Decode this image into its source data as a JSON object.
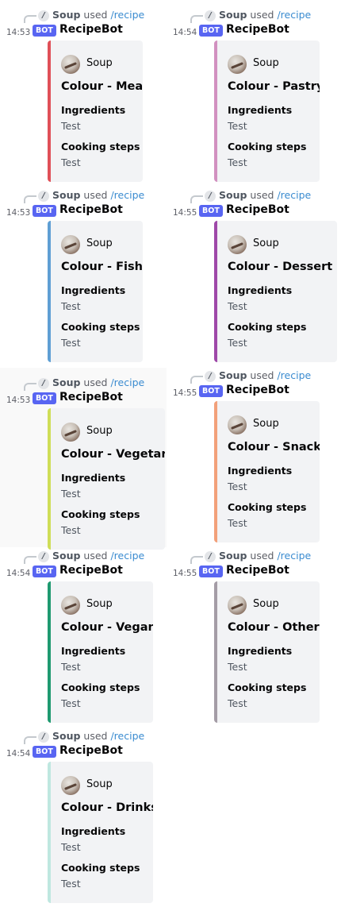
{
  "messages": [
    {
      "user": "Soup",
      "used": "used",
      "command": "/recipe",
      "time": "14:53",
      "badge": "BOT",
      "bot": "RecipeBot",
      "embed": {
        "author": "Soup",
        "title": "Colour - Meat",
        "color": "#e05058",
        "fields": [
          {
            "name": "Ingredients",
            "value": "Test"
          },
          {
            "name": "Cooking steps",
            "value": "Test"
          }
        ]
      }
    },
    {
      "user": "Soup",
      "used": "used",
      "command": "/recipe",
      "time": "14:54",
      "badge": "BOT",
      "bot": "RecipeBot",
      "embed": {
        "author": "Soup",
        "title": "Colour - Pastry",
        "color": "#d291c0",
        "fields": [
          {
            "name": "Ingredients",
            "value": "Test"
          },
          {
            "name": "Cooking steps",
            "value": "Test"
          }
        ]
      }
    },
    {
      "user": "Soup",
      "used": "used",
      "command": "/recipe",
      "time": "14:53",
      "badge": "BOT",
      "bot": "RecipeBot",
      "embed": {
        "author": "Soup",
        "title": "Colour - Fish",
        "color": "#5f9fd4",
        "fields": [
          {
            "name": "Ingredients",
            "value": "Test"
          },
          {
            "name": "Cooking steps",
            "value": "Test"
          }
        ]
      }
    },
    {
      "user": "Soup",
      "used": "used",
      "command": "/recipe",
      "time": "14:55",
      "badge": "BOT",
      "bot": "RecipeBot",
      "embed": {
        "author": "Soup",
        "title": "Colour - Dessert",
        "color": "#9e48a8",
        "fields": [
          {
            "name": "Ingredients",
            "value": "Test"
          },
          {
            "name": "Cooking steps",
            "value": "Test"
          }
        ]
      }
    },
    {
      "user": "Soup",
      "used": "used",
      "command": "/recipe",
      "time": "14:53",
      "badge": "BOT",
      "bot": "RecipeBot",
      "embed": {
        "author": "Soup",
        "title": "Colour - Vegetarian",
        "color": "#cfde58",
        "fields": [
          {
            "name": "Ingredients",
            "value": "Test"
          },
          {
            "name": "Cooking steps",
            "value": "Test"
          }
        ]
      }
    },
    {
      "user": "Soup",
      "used": "used",
      "command": "/recipe",
      "time": "14:55",
      "badge": "BOT",
      "bot": "RecipeBot",
      "embed": {
        "author": "Soup",
        "title": "Colour - Snack",
        "color": "#f2a07a",
        "fields": [
          {
            "name": "Ingredients",
            "value": "Test"
          },
          {
            "name": "Cooking steps",
            "value": "Test"
          }
        ]
      }
    },
    {
      "user": "Soup",
      "used": "used",
      "command": "/recipe",
      "time": "14:54",
      "badge": "BOT",
      "bot": "RecipeBot",
      "embed": {
        "author": "Soup",
        "title": "Colour - Vegan",
        "color": "#1f9a70",
        "fields": [
          {
            "name": "Ingredients",
            "value": "Test"
          },
          {
            "name": "Cooking steps",
            "value": "Test"
          }
        ]
      }
    },
    {
      "user": "Soup",
      "used": "used",
      "command": "/recipe",
      "time": "14:55",
      "badge": "BOT",
      "bot": "RecipeBot",
      "embed": {
        "author": "Soup",
        "title": "Colour - Other",
        "color": "#a49ca6",
        "fields": [
          {
            "name": "Ingredients",
            "value": "Test"
          },
          {
            "name": "Cooking steps",
            "value": "Test"
          }
        ]
      }
    },
    {
      "user": "Soup",
      "used": "used",
      "command": "/recipe",
      "time": "14:54",
      "badge": "BOT",
      "bot": "RecipeBot",
      "embed": {
        "author": "Soup",
        "title": "Colour - Drinks",
        "color": "#bfe7e0",
        "fields": [
          {
            "name": "Ingredients",
            "value": "Test"
          },
          {
            "name": "Cooking steps",
            "value": "Test"
          }
        ]
      }
    }
  ]
}
